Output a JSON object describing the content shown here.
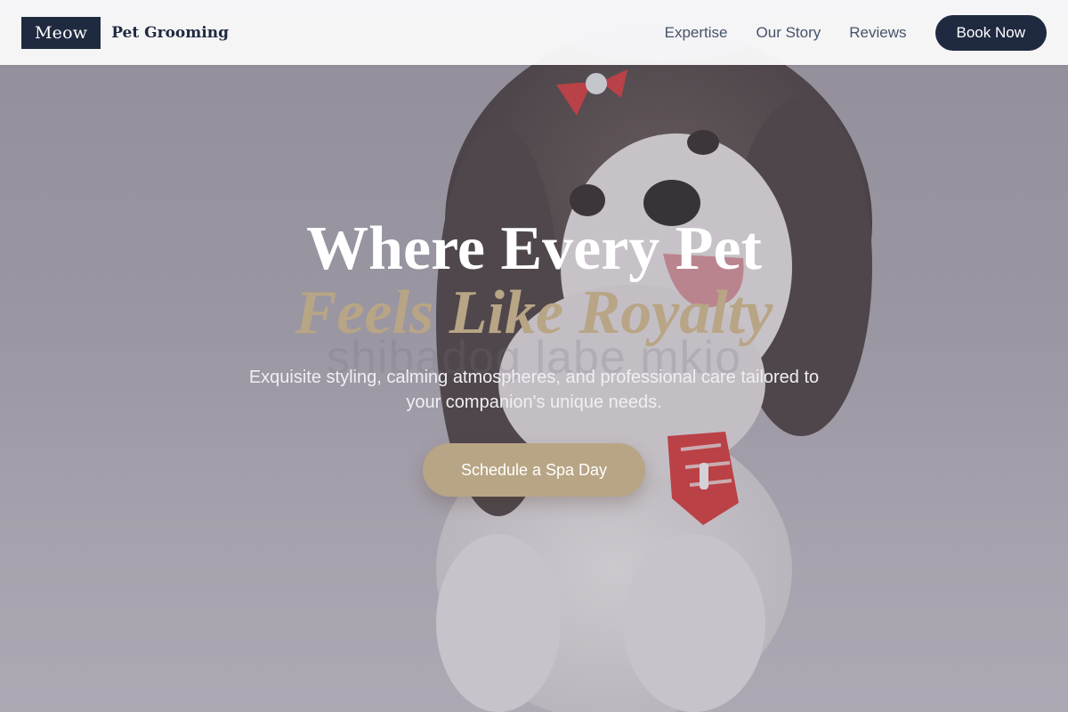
{
  "header": {
    "logo": "Meow",
    "brand": "Pet Grooming",
    "nav": [
      "Expertise",
      "Our Story",
      "Reviews"
    ],
    "cta": "Book Now"
  },
  "hero": {
    "title_line1": "Where Every Pet",
    "title_line2": "Feels Like Royalty",
    "watermark": "shibadog labe mkio",
    "subtitle": "Exquisite styling, calming atmospheres, and professional care tailored to your companion's unique needs.",
    "cta": "Schedule a Spa Day",
    "image_subject": "dog-photo"
  },
  "colors": {
    "navy": "#1f2a40",
    "gold": "#b8a585",
    "header_bg": "#f8f8f9"
  }
}
